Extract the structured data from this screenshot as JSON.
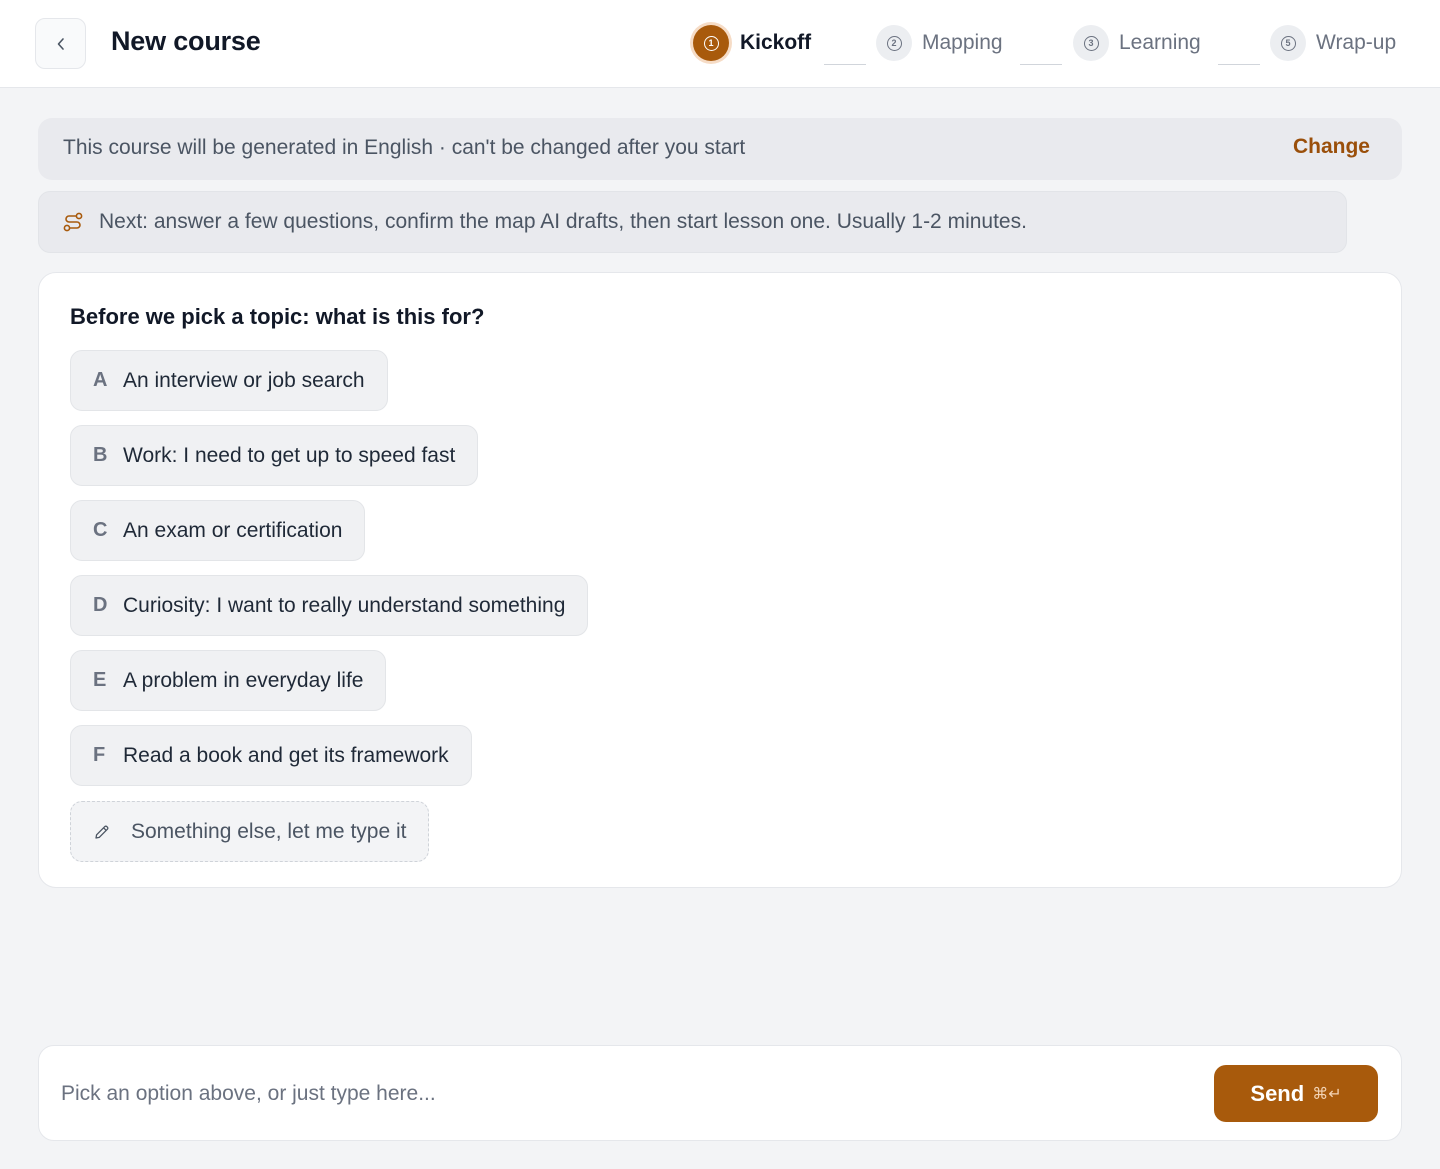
{
  "header": {
    "title": "New course",
    "back_icon": "chevron-left-icon",
    "steps": [
      {
        "number": "1",
        "label": "Kickoff",
        "state": "active"
      },
      {
        "number": "2",
        "label": "Mapping",
        "state": "upcoming"
      },
      {
        "number": "3",
        "label": "Learning",
        "state": "upcoming"
      },
      {
        "number": "5",
        "label": "Wrap-up",
        "state": "upcoming"
      }
    ]
  },
  "language_banner": {
    "text": "This course will be generated in English · can't be changed after you start",
    "action": "Change"
  },
  "next_banner": {
    "icon": "route-icon",
    "text": "Next: answer a few questions, confirm the map AI drafts, then start lesson one. Usually 1-2 minutes."
  },
  "question": {
    "title": "Before we pick a topic: what is this for?",
    "options": [
      {
        "letter": "A",
        "label": "An interview or job search"
      },
      {
        "letter": "B",
        "label": "Work: I need to get up to speed fast"
      },
      {
        "letter": "C",
        "label": "An exam or certification"
      },
      {
        "letter": "D",
        "label": "Curiosity: I want to really understand something"
      },
      {
        "letter": "E",
        "label": "A problem in everyday life"
      },
      {
        "letter": "F",
        "label": "Read a book and get its framework"
      }
    ],
    "other_option": {
      "icon": "pencil-icon",
      "label": "Something else, let me type it"
    }
  },
  "composer": {
    "placeholder": "Pick an option above, or just type here...",
    "value": "",
    "send_label": "Send",
    "send_shortcut": "⌘↵"
  },
  "colors": {
    "accent": "#a85a0c",
    "accent_text": "#9a4f0a",
    "background": "#f3f4f6"
  }
}
